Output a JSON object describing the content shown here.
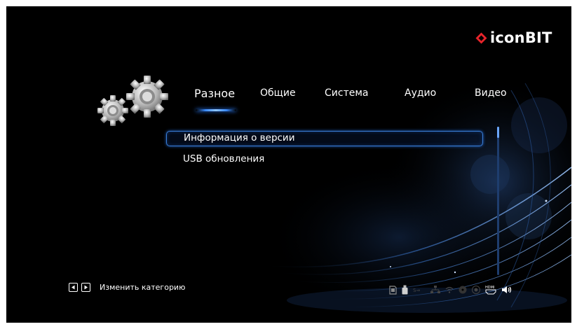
{
  "brand": {
    "name": "iconBIT",
    "diamond_color": "#e8242b"
  },
  "tabs": [
    {
      "label": "Разное",
      "active": true
    },
    {
      "label": "Общие",
      "active": false
    },
    {
      "label": "Система",
      "active": false
    },
    {
      "label": "Аудио",
      "active": false
    },
    {
      "label": "Видео",
      "active": false
    }
  ],
  "menu": {
    "items": [
      {
        "label": "Информация о версии",
        "selected": true
      },
      {
        "label": "USB обновления",
        "selected": false
      }
    ]
  },
  "hint": {
    "keys": [
      "left-arrow-key-icon",
      "right-arrow-key-icon"
    ],
    "text": "Изменить категорию"
  },
  "status_icons": [
    "sd-card-icon",
    "usb-drive-icon",
    "sata-icon",
    "network-icon",
    "wifi-icon",
    "disc-icon",
    "power-icon",
    "hdmi-icon",
    "volume-icon"
  ],
  "status_labels": {
    "hdmi": "HDMI"
  },
  "colors": {
    "accent": "#3a8bff",
    "background": "#000000",
    "text": "#ffffff"
  }
}
